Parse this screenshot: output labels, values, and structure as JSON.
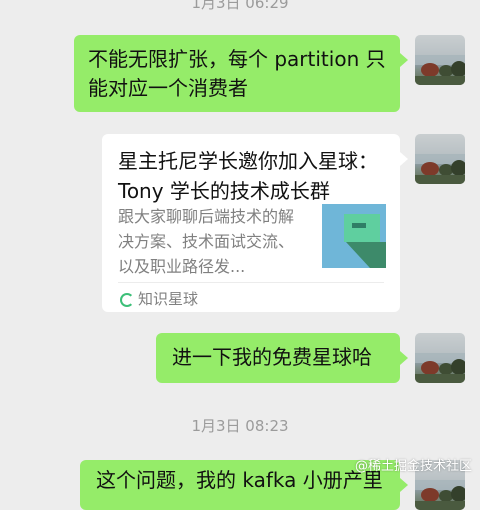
{
  "timestamps": {
    "top": "1月3日 06:29",
    "middle": "1月3日 08:23"
  },
  "messages": [
    {
      "text": "不能无限扩张，每个 partition 只能对应一个消费者"
    },
    {
      "card": {
        "title": "星主托尼学长邀你加入星球：Tony 学长的技术成长群",
        "description": "跟大家聊聊后端技术的解决方案、技术面试交流、以及职业路径发...",
        "source": "知识星球"
      }
    },
    {
      "text": "进一下我的免费星球哈"
    },
    {
      "text": "这个问题，我的 kafka 小册产里"
    }
  ],
  "watermark": "@稀土掘金技术社区",
  "colors": {
    "background": "#ededed",
    "my_bubble": "#95ec69",
    "card": "#ffffff",
    "timestamp": "#9b9b9b"
  }
}
